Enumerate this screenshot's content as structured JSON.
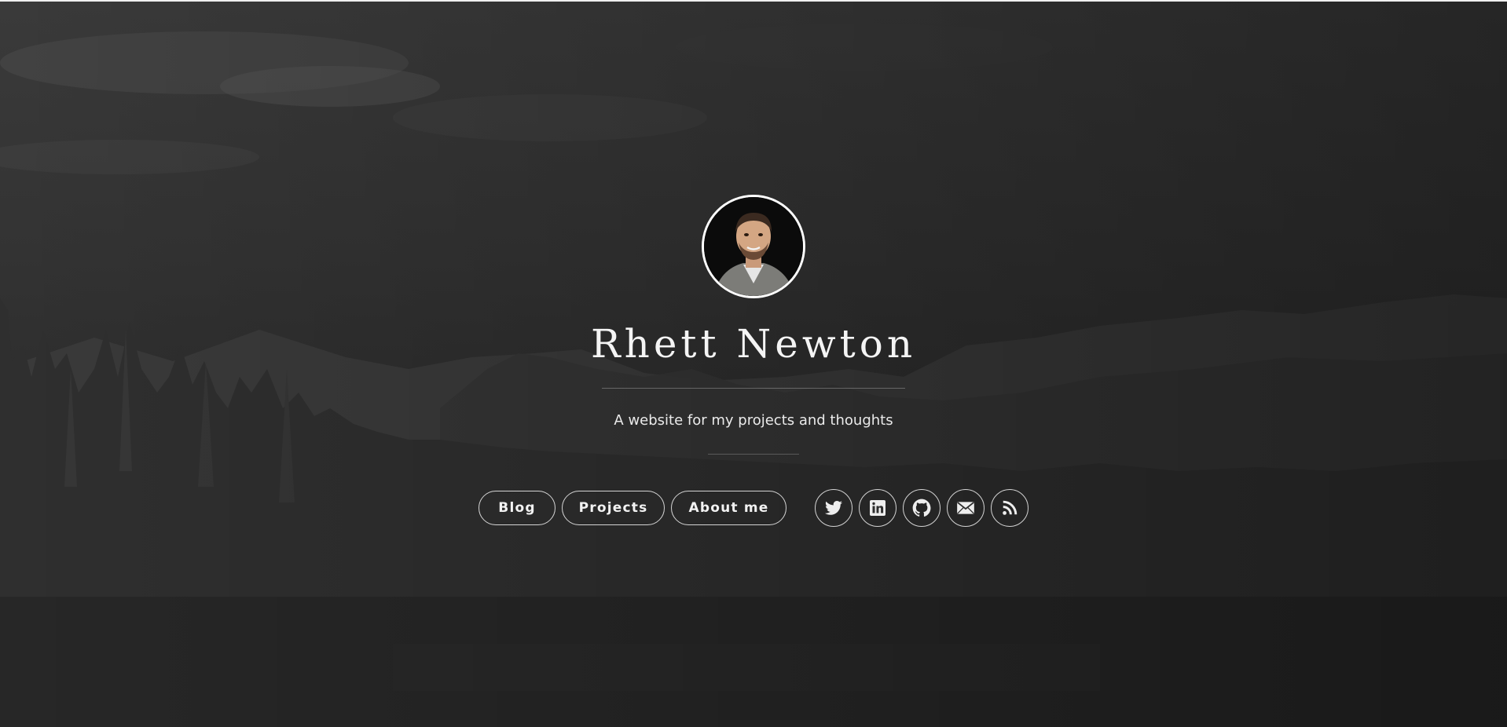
{
  "site": {
    "name": "Rhett Newton",
    "tagline": "A website for my projects and thoughts"
  },
  "nav": [
    {
      "label": "Blog"
    },
    {
      "label": "Projects"
    },
    {
      "label": "About me"
    }
  ],
  "social": [
    {
      "icon": "twitter-icon"
    },
    {
      "icon": "linkedin-icon"
    },
    {
      "icon": "github-icon"
    },
    {
      "icon": "email-icon"
    },
    {
      "icon": "rss-icon"
    }
  ],
  "colors": {
    "background": "#2e2e2e",
    "text": "#f4f4f4",
    "border": "#ffffff"
  }
}
